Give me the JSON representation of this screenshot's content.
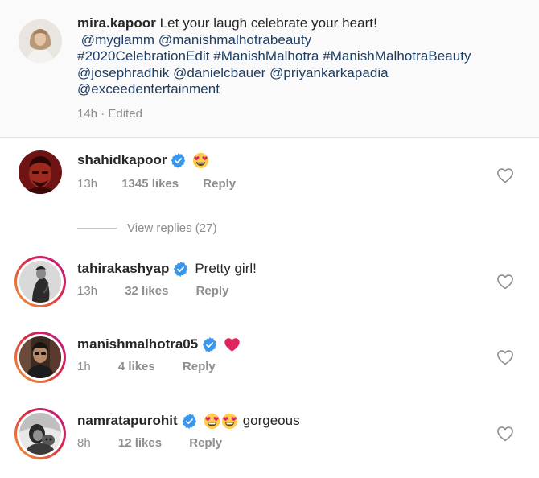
{
  "caption": {
    "username": "mira.kapoor",
    "text": "Let your laugh celebrate your heart!",
    "tags_line1": "@myglamm @manishmalhotrabeauty",
    "tags_line2": "#2020CelebrationEdit #ManishMalhotra #ManishMalhotraBeauty",
    "tags_line3": "@josephradhik @danielcbauer @priyankarkapadia",
    "tags_line4": "@exceedentertainment",
    "time": "14h",
    "separator": "·",
    "edited": "Edited"
  },
  "comments": [
    {
      "username": "shahidkapoor",
      "verified": true,
      "emojis": [
        "heart-eyes"
      ],
      "text": "",
      "time": "13h",
      "likes": "1345 likes",
      "reply": "Reply"
    },
    {
      "username": "tahirakashyap",
      "verified": true,
      "emojis": [],
      "text": "Pretty girl!",
      "time": "13h",
      "likes": "32 likes",
      "reply": "Reply"
    },
    {
      "username": "manishmalhotra05",
      "verified": true,
      "emojis": [
        "red-heart"
      ],
      "text": "",
      "time": "1h",
      "likes": "4 likes",
      "reply": "Reply"
    },
    {
      "username": "namratapurohit",
      "verified": true,
      "emojis": [
        "heart-eyes",
        "heart-eyes"
      ],
      "text": "gorgeous",
      "time": "8h",
      "likes": "12 likes",
      "reply": "Reply"
    }
  ],
  "view_replies": "View replies (27)",
  "colors": {
    "text": "#262626",
    "secondary": "#8e8e8e",
    "link": "#1e3d62",
    "verified": "#3897f0",
    "like_heart": "#ed4956"
  },
  "icons": {
    "verified": "verified-badge-icon",
    "like": "heart-outline-icon",
    "heart_eyes": "heart-eyes-emoji-icon",
    "red_heart": "red-heart-emoji-icon"
  }
}
